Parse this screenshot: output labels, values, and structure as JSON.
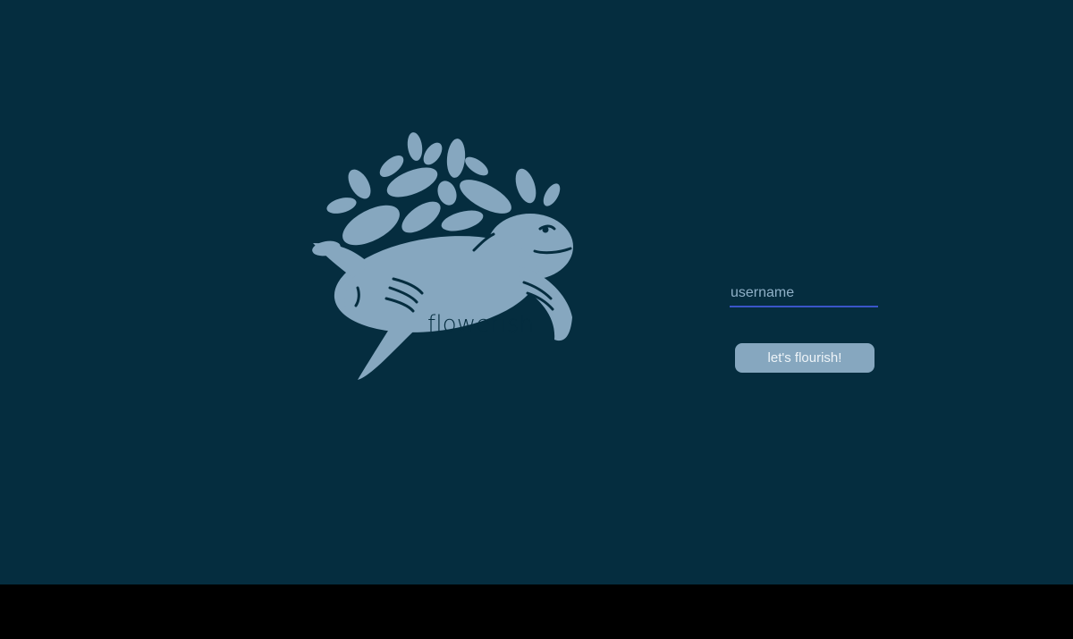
{
  "app": {
    "brand": "flowerish",
    "logo_icon": "sea-turtle-with-leaves-logo",
    "colors": {
      "background": "#052d3f",
      "logo": "#86a7bf",
      "input_underline": "#3a55c8",
      "button": "#86a7bf"
    }
  },
  "login": {
    "username_placeholder": "username",
    "username_value": "",
    "submit_label": "let's flourish!"
  }
}
